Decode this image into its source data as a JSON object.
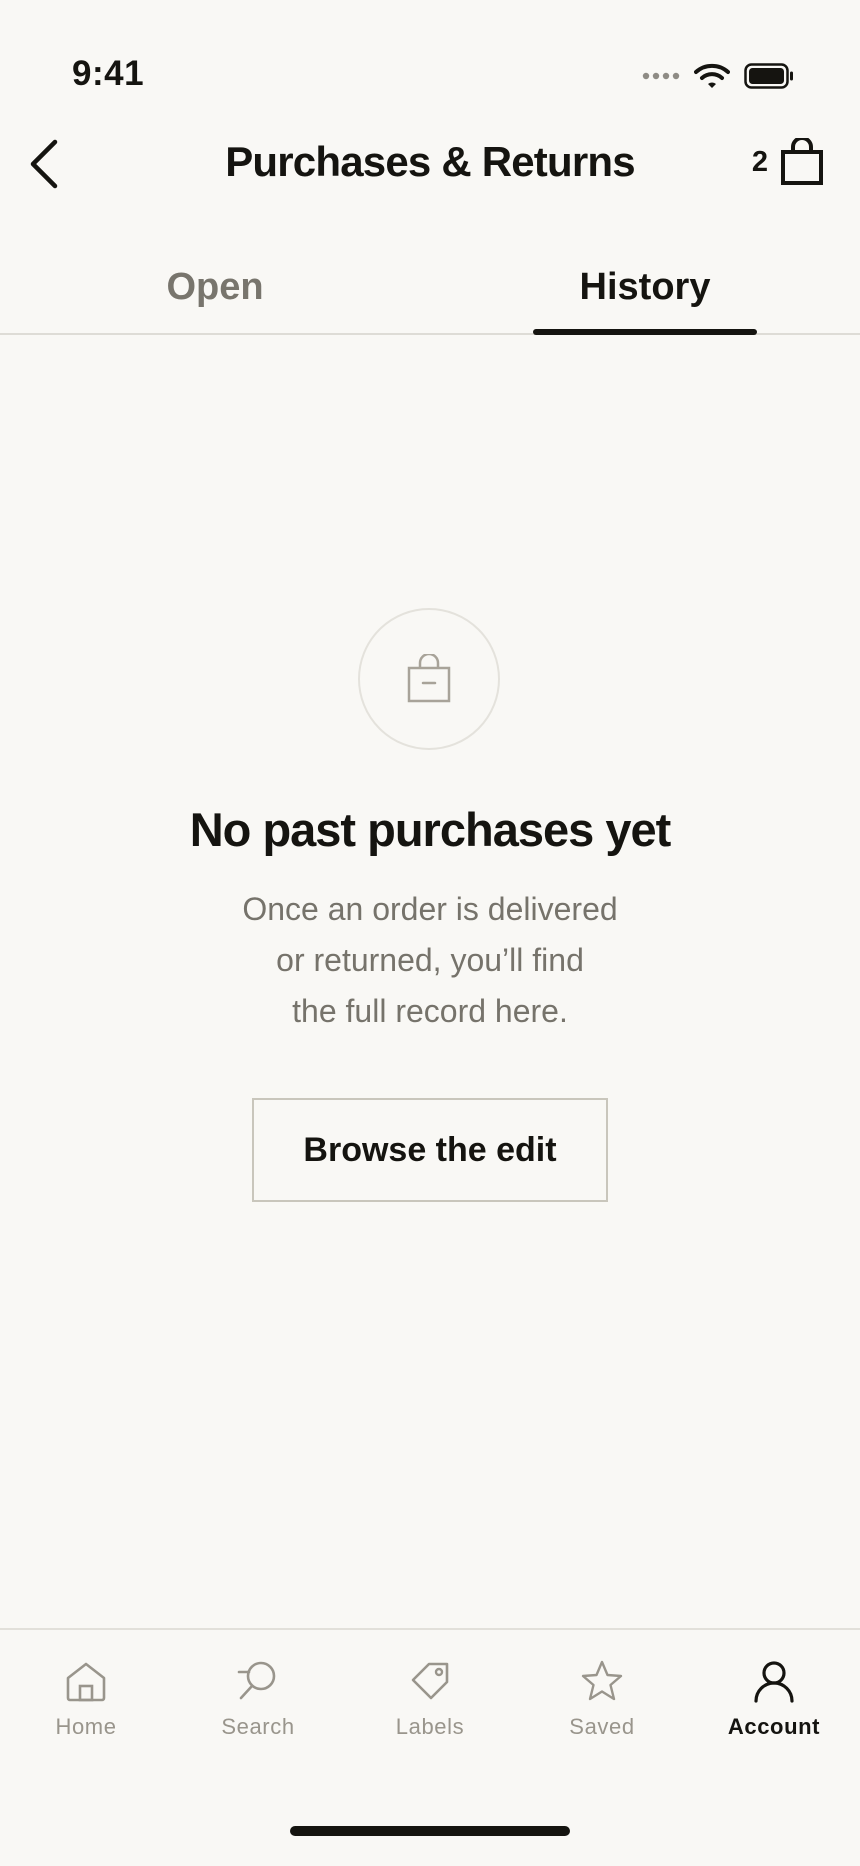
{
  "status_bar": {
    "time": "9:41"
  },
  "header": {
    "title": "Purchases & Returns",
    "bag_count": "2"
  },
  "tabs": [
    {
      "label": "Open",
      "active": false
    },
    {
      "label": "History",
      "active": true
    }
  ],
  "empty_state": {
    "icon": "shopping-bag-icon",
    "title": "No past purchases yet",
    "body_lines": [
      "Once an order is delivered",
      "or returned, you’ll find",
      "the full record here."
    ],
    "button_label": "Browse the edit"
  },
  "bottom_nav": {
    "items": [
      {
        "label": "Home",
        "icon": "home-icon",
        "active": false
      },
      {
        "label": "Search",
        "icon": "search-icon",
        "active": false
      },
      {
        "label": "Labels",
        "icon": "tag-icon",
        "active": false
      },
      {
        "label": "Saved",
        "icon": "star-icon",
        "active": false
      },
      {
        "label": "Account",
        "icon": "account-icon",
        "active": true
      }
    ]
  },
  "colors": {
    "background": "#f9f8f5",
    "text_primary": "#151410",
    "text_secondary": "#76736b",
    "inactive": "#99958c"
  }
}
